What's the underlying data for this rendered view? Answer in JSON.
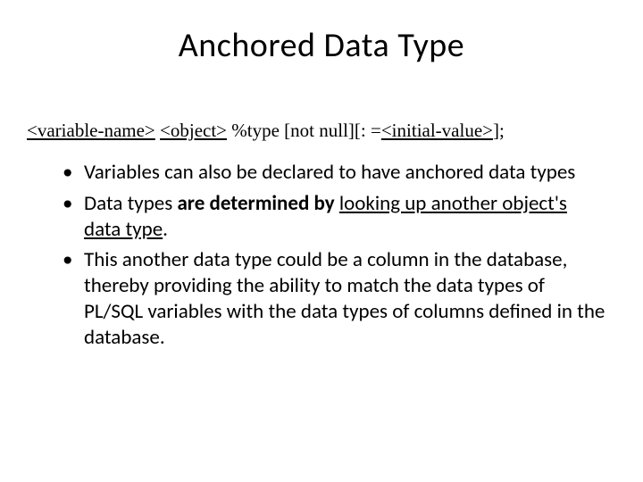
{
  "title": "Anchored Data Type",
  "syntax": {
    "t1": "<variable-name>",
    "gap1": " ",
    "t2": "<object>",
    "t3": " %type  [not null][: =",
    "t4": "<initial-value>",
    "t5": "];"
  },
  "bullets": {
    "b1": "Variables can also be declared to have anchored data types",
    "b2a": "Data types ",
    "b2b": "are determined by",
    "b2c": " ",
    "b2d": "looking up another object's data type",
    "b2e": ".",
    "b3": "This another data type could be a column in the database, thereby providing the ability to match the data types of PL/SQL variables with the data types of columns defined in the database."
  }
}
